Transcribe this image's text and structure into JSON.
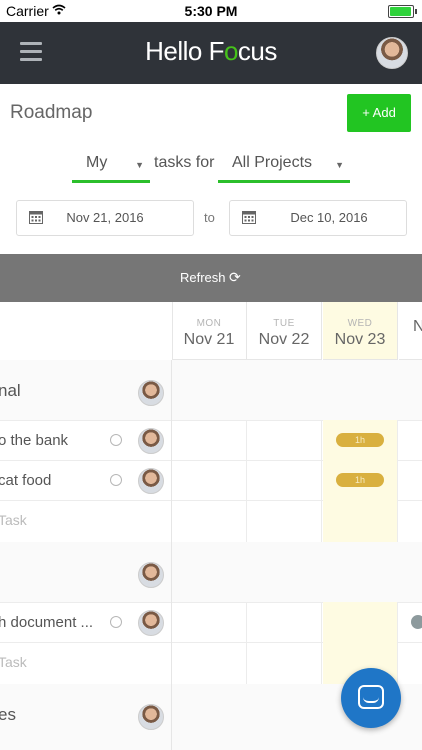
{
  "status_bar": {
    "carrier": "Carrier",
    "time": "5:30 PM"
  },
  "nav": {
    "logo_pre": "Hello F",
    "logo_o": "o",
    "logo_post": "cus"
  },
  "header": {
    "title": "Roadmap",
    "add_label": "+ Add"
  },
  "filters": {
    "owner": "My",
    "tasks_for": "tasks for",
    "project": "All Projects",
    "start_date": "Nov 21, 2016",
    "to": "to",
    "end_date": "Dec 10, 2016"
  },
  "refresh": {
    "label": "Refresh"
  },
  "calendar": {
    "days": [
      {
        "dow": "MON",
        "date": "Nov 21"
      },
      {
        "dow": "TUE",
        "date": "Nov 22"
      },
      {
        "dow": "WED",
        "date": "Nov 23"
      },
      {
        "dow": "",
        "date": "N"
      }
    ]
  },
  "rows": [
    {
      "kind": "group",
      "label": "nal"
    },
    {
      "kind": "task",
      "label": "o the bank",
      "pill": "1h"
    },
    {
      "kind": "task",
      "label": "cat food",
      "pill": "1h"
    },
    {
      "kind": "new",
      "label": "Task"
    },
    {
      "kind": "group",
      "label": ""
    },
    {
      "kind": "task",
      "label": "h document ..."
    },
    {
      "kind": "new",
      "label": "Task"
    },
    {
      "kind": "group",
      "label": "es"
    }
  ],
  "colors": {
    "nav_bg": "#2f3339",
    "accent_green": "#22c522",
    "today_bg": "#fefbe2",
    "pill": "#d9b03f",
    "chat": "#1f76c7"
  }
}
